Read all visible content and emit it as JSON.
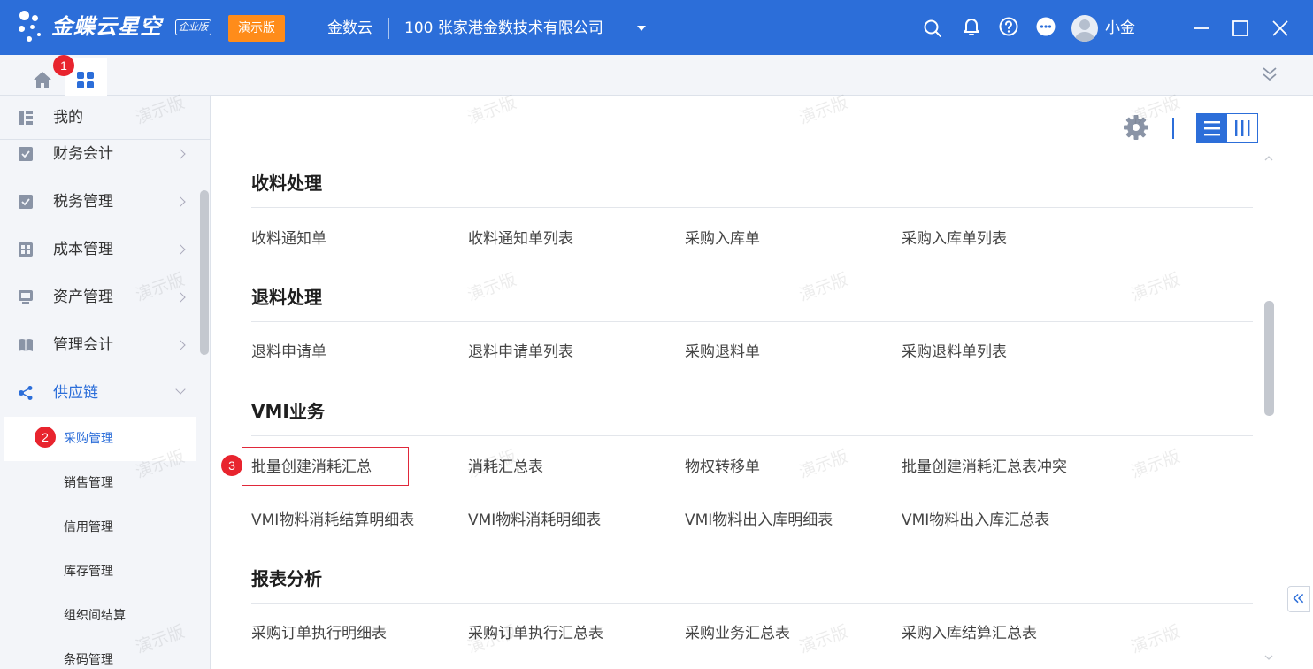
{
  "topbar": {
    "brand": "金蝶云星空",
    "brand_badge": "企业版",
    "demo_badge": "演示版",
    "tenant": "金数云",
    "org": "100  张家港金数技术有限公司",
    "username": "小金",
    "icons": [
      "search-icon",
      "bell-icon",
      "help-icon",
      "more-icon",
      "avatar",
      "minimize-icon",
      "maximize-icon",
      "close-icon"
    ]
  },
  "tabstrip": {
    "home_icon": "home-icon",
    "apps_icon": "apps-grid-icon",
    "badge_1": "1"
  },
  "sidebar": {
    "my_label": "我的",
    "items": [
      {
        "label": "财务会计",
        "icon": "ledger-icon"
      },
      {
        "label": "税务管理",
        "icon": "tax-icon"
      },
      {
        "label": "成本管理",
        "icon": "cost-icon"
      },
      {
        "label": "资产管理",
        "icon": "asset-icon"
      },
      {
        "label": "管理会计",
        "icon": "book-icon"
      },
      {
        "label": "供应链",
        "icon": "supply-chain-icon"
      }
    ],
    "sub_items": [
      {
        "label": "采购管理"
      },
      {
        "label": "销售管理"
      },
      {
        "label": "信用管理"
      },
      {
        "label": "库存管理"
      },
      {
        "label": "组织间结算"
      },
      {
        "label": "条码管理"
      }
    ],
    "badge_2": "2"
  },
  "main": {
    "badge_3": "3",
    "sections": [
      {
        "title": "收料处理",
        "links": [
          "收料通知单",
          "收料通知单列表",
          "采购入库单",
          "采购入库单列表"
        ]
      },
      {
        "title": "退料处理",
        "links": [
          "退料申请单",
          "退料申请单列表",
          "采购退料单",
          "采购退料单列表"
        ]
      },
      {
        "title": "VMI业务",
        "links": [
          "批量创建消耗汇总",
          "消耗汇总表",
          "物权转移单",
          "批量创建消耗汇总表冲突",
          "VMI物料消耗结算明细表",
          "VMI物料消耗明细表",
          "VMI物料出入库明细表",
          "VMI物料出入库汇总表"
        ]
      },
      {
        "title": "报表分析",
        "links": [
          "采购订单执行明细表",
          "采购订单执行汇总表",
          "采购业务汇总表",
          "采购入库结算汇总表"
        ]
      }
    ]
  },
  "watermark": "演示版",
  "colors": {
    "primary": "#2c6ed9",
    "demo": "#ff8c1a",
    "badge": "#e8242e"
  }
}
